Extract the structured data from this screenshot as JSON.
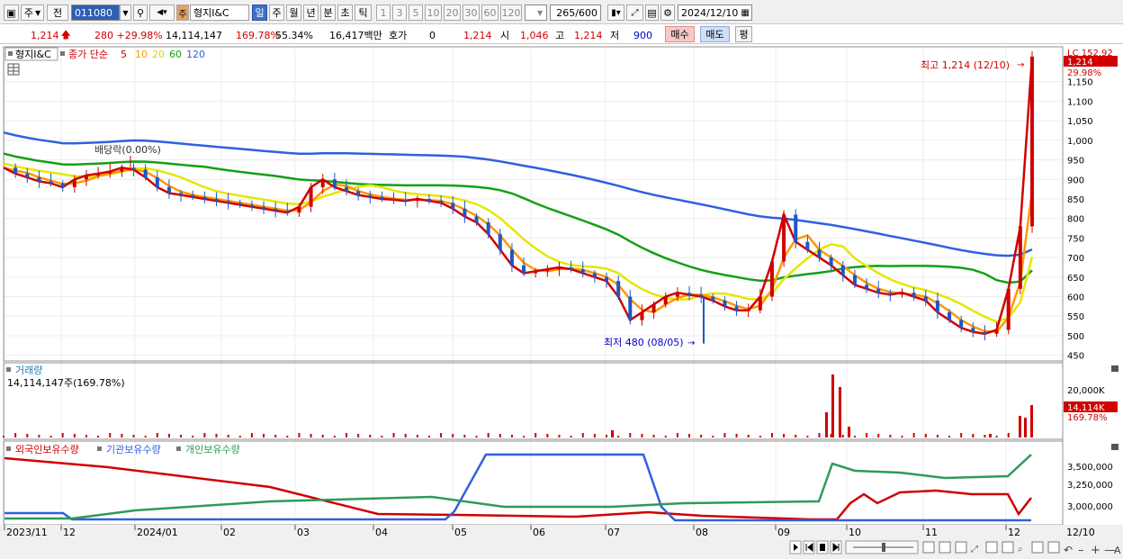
{
  "toolbar": {
    "period_label": "주",
    "prev_label": "전",
    "code": "011080",
    "stock_name": "형지I&C",
    "stock_badge": "주",
    "intervals": [
      "일",
      "주",
      "월",
      "년",
      "분",
      "초",
      "틱"
    ],
    "active_interval": "일",
    "periods": [
      "1",
      "3",
      "5",
      "10",
      "20",
      "30",
      "60",
      "120"
    ],
    "count": "265/600",
    "date": "2024/12/10"
  },
  "quote": {
    "price": "1,214",
    "change": "280 +29.98%",
    "volume": "14,114,147",
    "volume_ratio": "169.78%",
    "ratio2": "55.34%",
    "amount": "16,417백만",
    "hoga_label": "호가",
    "hoga_value": "0",
    "hoga_price": "1,214",
    "open_label": "시",
    "open": "1,046",
    "high_label": "고",
    "high": "1,214",
    "low_label": "저",
    "low": "900",
    "buy_label": "매수",
    "sell_label": "매도",
    "eval_label": "평"
  },
  "price_panel": {
    "name": "형지I&C",
    "ma_label": "종가 단순",
    "ma_periods": [
      "5",
      "10",
      "20",
      "60",
      "120"
    ],
    "ma_colors": {
      "5": "#d00000",
      "10": "#ff9900",
      "20": "#e6e600",
      "60": "#13a013",
      "120": "#3060e0"
    },
    "annotation_dividend": "배당락(0.00%)",
    "annotation_high": "최고 1,214 (12/10)",
    "annotation_low": "최저 480 (08/05)",
    "price_tag": "1,214",
    "pct_tag": "29.98%",
    "top_label": "LC 152.92",
    "yticks": [
      "1,150",
      "1,100",
      "1,050",
      "1,000",
      "950",
      "900",
      "850",
      "800",
      "750",
      "700",
      "650",
      "600",
      "550",
      "500",
      "450"
    ]
  },
  "volume_panel": {
    "label": "거래량",
    "value_text": "14,114,147주(169.78%)",
    "ytick": "20,000K",
    "tag": "14,114K",
    "tag_pct": "169.78%"
  },
  "holdings_panel": {
    "labels": [
      "외국인보유수량",
      "기관보유수량",
      "개인보유수량"
    ],
    "colors": [
      "#d00000",
      "#3060e0",
      "#2e9a5a"
    ],
    "yticks": [
      "3,500,000",
      "3,250,000",
      "3,000,000"
    ]
  },
  "x_axis": {
    "labels": [
      "2023/11",
      "12",
      "2024/01",
      "02",
      "03",
      "04",
      "05",
      "06",
      "07",
      "08",
      "09",
      "10",
      "11",
      "12"
    ],
    "last": "12/10"
  },
  "chart_data": {
    "type": "candlestick",
    "y_range": [
      440,
      1230
    ],
    "high": {
      "value": 1214,
      "date": "12/10"
    },
    "low": {
      "value": 480,
      "date": "08/05"
    },
    "months": [
      "2023/11",
      "12",
      "2024/01",
      "02",
      "03",
      "04",
      "05",
      "06",
      "07",
      "08",
      "09",
      "10",
      "11",
      "12"
    ],
    "close_path": [
      930,
      915,
      905,
      895,
      890,
      880,
      900,
      910,
      915,
      920,
      930,
      925,
      905,
      880,
      865,
      860,
      855,
      850,
      845,
      840,
      835,
      830,
      825,
      820,
      815,
      830,
      880,
      900,
      880,
      870,
      860,
      855,
      850,
      848,
      845,
      850,
      845,
      840,
      825,
      805,
      790,
      760,
      720,
      680,
      660,
      665,
      670,
      675,
      670,
      660,
      650,
      640,
      600,
      540,
      560,
      580,
      600,
      610,
      605,
      600,
      590,
      575,
      565,
      565,
      600,
      690,
      810,
      740,
      720,
      700,
      680,
      655,
      630,
      620,
      610,
      605,
      610,
      600,
      590,
      560,
      540,
      520,
      510,
      505,
      515,
      620,
      780,
      1214
    ]
  }
}
